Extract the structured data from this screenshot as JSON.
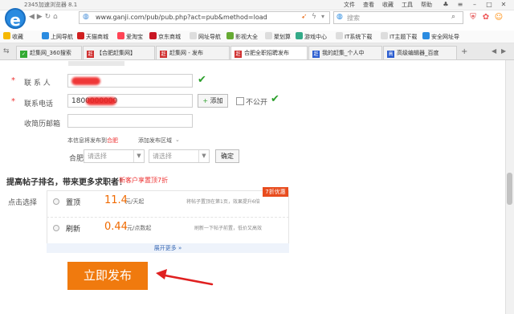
{
  "titlebar": {
    "title": "2345加速浏览器 8.1",
    "menus": [
      "文件",
      "查看",
      "收藏",
      "工具",
      "帮助"
    ]
  },
  "toolbar": {
    "url": "www.ganji.com/pub/pub.php?act=pub&method=load",
    "search_placeholder": "搜索"
  },
  "bookmarks": {
    "items": [
      "收藏",
      "上网导航",
      "天猫商城",
      "爱淘宝",
      "京东商城",
      "网址导航",
      "影视大全",
      "聚划算",
      "游戏中心",
      "IT系统下载",
      "IT主题下载",
      "安全网址导"
    ]
  },
  "tabs": [
    {
      "label": "赶集网_360搜索"
    },
    {
      "label": "【合肥赶集网】"
    },
    {
      "label": "赶集网 - 发布"
    },
    {
      "label": "合肥全职招聘发布"
    },
    {
      "label": "我的赶集_个人中"
    },
    {
      "label": "高级编辑器_百度"
    }
  ],
  "form": {
    "contact_label": "联 系 人",
    "phone_label": "联系电话",
    "phone_value": "1800000000",
    "add_button": "添加",
    "hide_checkbox_label": "不公开",
    "resume_email_label": "收简历邮箱",
    "publish_to_prefix": "本信息将发布到",
    "publish_city": "合肥",
    "add_area_link": "添加发布区域",
    "city_label": "合肥",
    "select1_placeholder": "请选择",
    "select2_placeholder": "请选择",
    "confirm_button": "确定"
  },
  "promo": {
    "heading": "提高帖子排名，带来更多求职者！",
    "new_user_offer": "新客户享置顶7折",
    "click_select_label": "点击选择",
    "badge": "7折优惠",
    "options": [
      {
        "name": "置顶",
        "price": "11.4",
        "unit": "元/天起",
        "desc": "将帖子置顶在第1页，效果提升6倍"
      },
      {
        "name": "刷新",
        "price": "0.44",
        "unit": "元/点数起",
        "desc": "刷新一下帖子前置，低价又高效"
      }
    ],
    "expand_more": "展开更多"
  },
  "publish_button": "立即发布",
  "colors": {
    "accent_orange": "#f07a0e",
    "required_red": "#e33333",
    "check_green": "#2ca02c",
    "link_blue": "#3a6ab5"
  }
}
